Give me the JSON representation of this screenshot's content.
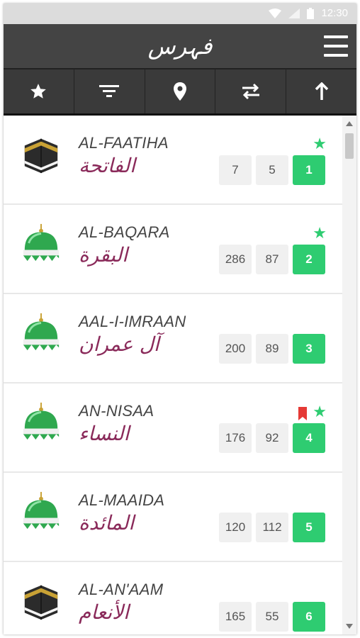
{
  "statusbar": {
    "time": "12:30"
  },
  "appbar": {
    "title": "فہرس"
  },
  "toolbar": [
    "star-icon",
    "filter-icon",
    "location-pin-icon",
    "swap-icon",
    "arrow-up-icon"
  ],
  "items": [
    {
      "id": "1",
      "en": "AL-FAATIHA",
      "ar": "الفاتحة",
      "ayat": "7",
      "ruku": "5",
      "num": "1",
      "icon": "kaaba",
      "starred": true,
      "bookmarked": false
    },
    {
      "id": "2",
      "en": "AL-BAQARA",
      "ar": "البقرة",
      "ayat": "286",
      "ruku": "87",
      "num": "2",
      "icon": "dome",
      "starred": true,
      "bookmarked": false
    },
    {
      "id": "3",
      "en": "AAL-I-IMRAAN",
      "ar": "آل عمران",
      "ayat": "200",
      "ruku": "89",
      "num": "3",
      "icon": "dome",
      "starred": false,
      "bookmarked": false
    },
    {
      "id": "4",
      "en": "AN-NISAA",
      "ar": "النساء",
      "ayat": "176",
      "ruku": "92",
      "num": "4",
      "icon": "dome",
      "starred": true,
      "bookmarked": true
    },
    {
      "id": "5",
      "en": "AL-MAAIDA",
      "ar": "المائدة",
      "ayat": "120",
      "ruku": "112",
      "num": "5",
      "icon": "dome",
      "starred": false,
      "bookmarked": false
    },
    {
      "id": "6",
      "en": "AL-AN'AAM",
      "ar": "الأنعام",
      "ayat": "165",
      "ruku": "55",
      "num": "6",
      "icon": "kaaba",
      "starred": false,
      "bookmarked": false
    }
  ],
  "colors": {
    "accent": "#2ecc71",
    "arabic": "#8a2a5a",
    "appbar": "#444444",
    "bookmark": "#e53935"
  }
}
